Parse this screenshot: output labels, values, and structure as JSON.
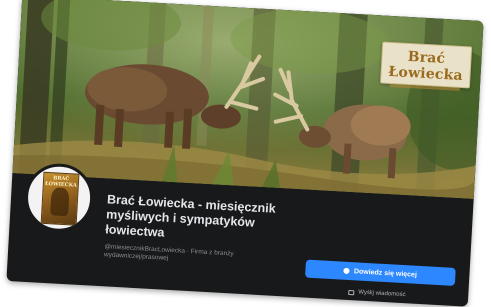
{
  "page": {
    "name": "Brać Łowiecka - miesięcznik myśliwych i sympatyków łowiectwa",
    "subtitle": "@miesiecznikBracLowiecka · Firma z branży wydawniczej/prasowej"
  },
  "cover": {
    "badge_title": "Brać Łowiecka"
  },
  "profile": {
    "thumbnail_title": "BRAĆ ŁOWIECKA"
  },
  "actions": {
    "follow_label": "Dowiedz się więcej",
    "secondary_label": "Wyślij wiadomość"
  },
  "colors": {
    "background": "#18191a",
    "primary_button": "#2d88ff",
    "title_text": "#e4e6eb",
    "muted_text": "#8a8d91"
  },
  "icons": {
    "follow": "info-icon",
    "secondary": "message-icon"
  }
}
